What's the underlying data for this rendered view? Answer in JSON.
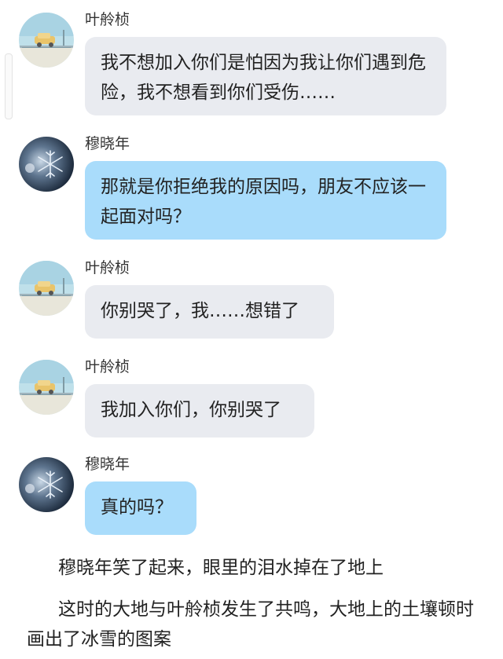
{
  "messages": [
    {
      "sender": "叶舲桢",
      "text": "我不想加入你们是怕因为我让你们遇到危险，我不想看到你们受伤……",
      "side": "left",
      "bubble_color": "#e9ebf0",
      "avatar": "beach-car-avatar"
    },
    {
      "sender": "穆晓年",
      "text": "那就是你拒绝我的原因吗，朋友不应该一起面对吗？",
      "side": "left",
      "bubble_color": "#a9dcfb",
      "avatar": "snowflake-avatar"
    },
    {
      "sender": "叶舲桢",
      "text": "你别哭了，我……想错了",
      "side": "left",
      "bubble_color": "#e9ebf0",
      "avatar": "beach-car-avatar"
    },
    {
      "sender": "叶舲桢",
      "text": "我加入你们，你别哭了",
      "side": "left",
      "bubble_color": "#e9ebf0",
      "avatar": "beach-car-avatar"
    },
    {
      "sender": "穆晓年",
      "text": "真的吗？",
      "side": "left",
      "bubble_color": "#a9dcfb",
      "avatar": "snowflake-avatar"
    }
  ],
  "narration": [
    "穆晓年笑了起来，眼里的泪水掉在了地上",
    "这时的大地与叶舲桢发生了共鸣，大地上的土壤顿时画出了冰雪的图案"
  ]
}
